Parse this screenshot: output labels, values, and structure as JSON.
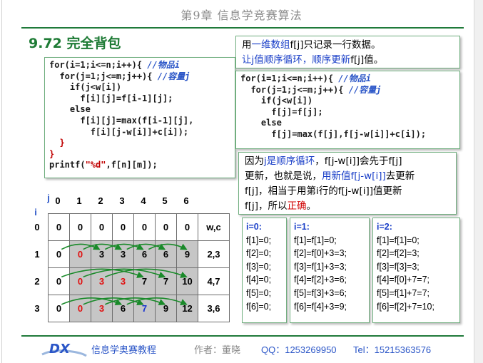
{
  "chapter_title": "第9章 信息学竞赛算法",
  "section": {
    "number": "9.72",
    "title": "完全背包"
  },
  "code_left": [
    [
      [
        "kw",
        "for(i=1;i<=n;i++){ "
      ],
      [
        "cm",
        "//物品i"
      ]
    ],
    [
      [
        "kw",
        "  for(j=1;j<=m;j++){ "
      ],
      [
        "cm",
        "//容量j"
      ]
    ],
    [
      [
        "kw",
        "    if(j<w[i])"
      ]
    ],
    [
      [
        "kw",
        "      f[i][j]=f[i-1][j];"
      ]
    ],
    [
      [
        "kw",
        "    else"
      ]
    ],
    [
      [
        "kw",
        "      f[i][j]=max(f[i-1][j],"
      ]
    ],
    [
      [
        "kw",
        "        f[i][j-w[i]]+c[i]);"
      ]
    ],
    [
      [
        "lbr",
        "  }"
      ]
    ],
    [
      [
        "lbr",
        "}"
      ]
    ],
    [
      [
        "kw",
        "printf("
      ],
      [
        "str",
        "\"%d\""
      ],
      [
        "kw",
        ",f[n][m]);"
      ]
    ]
  ],
  "note_top": {
    "line1": [
      [
        "",
        "用"
      ],
      [
        "blue",
        "一维数组"
      ],
      [
        "",
        "f[j]只记录一行数据。"
      ]
    ],
    "line2": [
      [
        "blue",
        "让j值顺序循环，顺序更新"
      ],
      [
        "",
        "f[j]值。"
      ]
    ]
  },
  "code_right": [
    [
      [
        "kw",
        "for(i=1;i<=n;i++){ "
      ],
      [
        "cm",
        "//物品i"
      ]
    ],
    [
      [
        "kw",
        "  for(j=1;j<=m;j++){ "
      ],
      [
        "cm",
        "//容量j"
      ]
    ],
    [
      [
        "kw",
        "    if(j<w[i])"
      ]
    ],
    [
      [
        "kw",
        "      f[j]=f[j];"
      ]
    ],
    [
      [
        "kw",
        "    else"
      ]
    ],
    [
      [
        "kw",
        "      f[j]=max(f[j],f[j-w[i]]+c[i]);"
      ]
    ]
  ],
  "note_bottom": {
    "line1": [
      [
        "",
        "因为"
      ],
      [
        "blue",
        "j是顺序循环"
      ],
      [
        "",
        "，f[j-w[i]]会先于f[j]"
      ]
    ],
    "line2": [
      [
        "",
        "更新，也就是说，"
      ],
      [
        "blue",
        "用新值f[j-w[i]]"
      ],
      [
        "",
        "去更新"
      ]
    ],
    "line3": [
      [
        "",
        "f[j]，相当于用第i行的f[j-w[i]]值更新"
      ]
    ],
    "line4": [
      [
        "",
        "f[j]，所以"
      ],
      [
        "red",
        "正确"
      ],
      [
        "",
        "。"
      ]
    ]
  },
  "grid": {
    "j_label": "j",
    "i_label": "i",
    "col_headers": [
      "0",
      "1",
      "2",
      "3",
      "4",
      "5",
      "6"
    ],
    "row_headers": [
      "0",
      "1",
      "2",
      "3"
    ],
    "rows": [
      {
        "cells": [
          "0",
          "0",
          "0",
          "0",
          "0",
          "0",
          "0"
        ],
        "wc": "w,c",
        "colors": [
          "",
          "",
          "",
          "",
          "",
          "",
          ""
        ]
      },
      {
        "cells": [
          "0",
          "0",
          "3",
          "3",
          "6",
          "6",
          "9"
        ],
        "wc": "2,3",
        "colors": [
          "",
          "r",
          "",
          "",
          "",
          "",
          ""
        ]
      },
      {
        "cells": [
          "0",
          "0",
          "3",
          "3",
          "7",
          "7",
          "10"
        ],
        "wc": "4,7",
        "colors": [
          "",
          "r",
          "r",
          "r",
          "",
          "",
          ""
        ]
      },
      {
        "cells": [
          "0",
          "0",
          "3",
          "6",
          "7",
          "9",
          "12"
        ],
        "wc": "3,6",
        "colors": [
          "",
          "r",
          "r",
          "",
          "b",
          "",
          ""
        ]
      }
    ]
  },
  "iterations": [
    {
      "header": "i=0:",
      "lines": [
        "f[1]=0;",
        "f[2]=0;",
        "f[3]=0;",
        "f[4]=0;",
        "f[5]=0;",
        "f[6]=0;"
      ]
    },
    {
      "header": "i=1:",
      "lines": [
        "f[1]=f[1]=0;",
        "f[2]=f[0]+3=3;",
        "f[3]=f[1]+3=3;",
        "f[4]=f[2]+3=6;",
        "f[5]=f[3]+3=6;",
        "f[6]=f[4]+3=9;"
      ]
    },
    {
      "header": "i=2:",
      "lines": [
        "f[1]=f[1]=0;",
        "f[2]=f[2]=3;",
        "f[3]=f[3]=3;",
        "f[4]=f[0]+7=7;",
        "f[5]=f[1]+7=7;",
        "f[6]=f[2]+7=10;"
      ]
    }
  ],
  "footer": {
    "book": "信息学奥赛教程",
    "author": "作者：董晓",
    "qq": "QQ：1253269950",
    "tel": "Tel：15215363576"
  },
  "colors": {
    "accent_green": "#1e7b35",
    "code_comment": "#2a55c7",
    "arrow": "#1a8a2a",
    "cell_shade": "#c6c6c6"
  }
}
